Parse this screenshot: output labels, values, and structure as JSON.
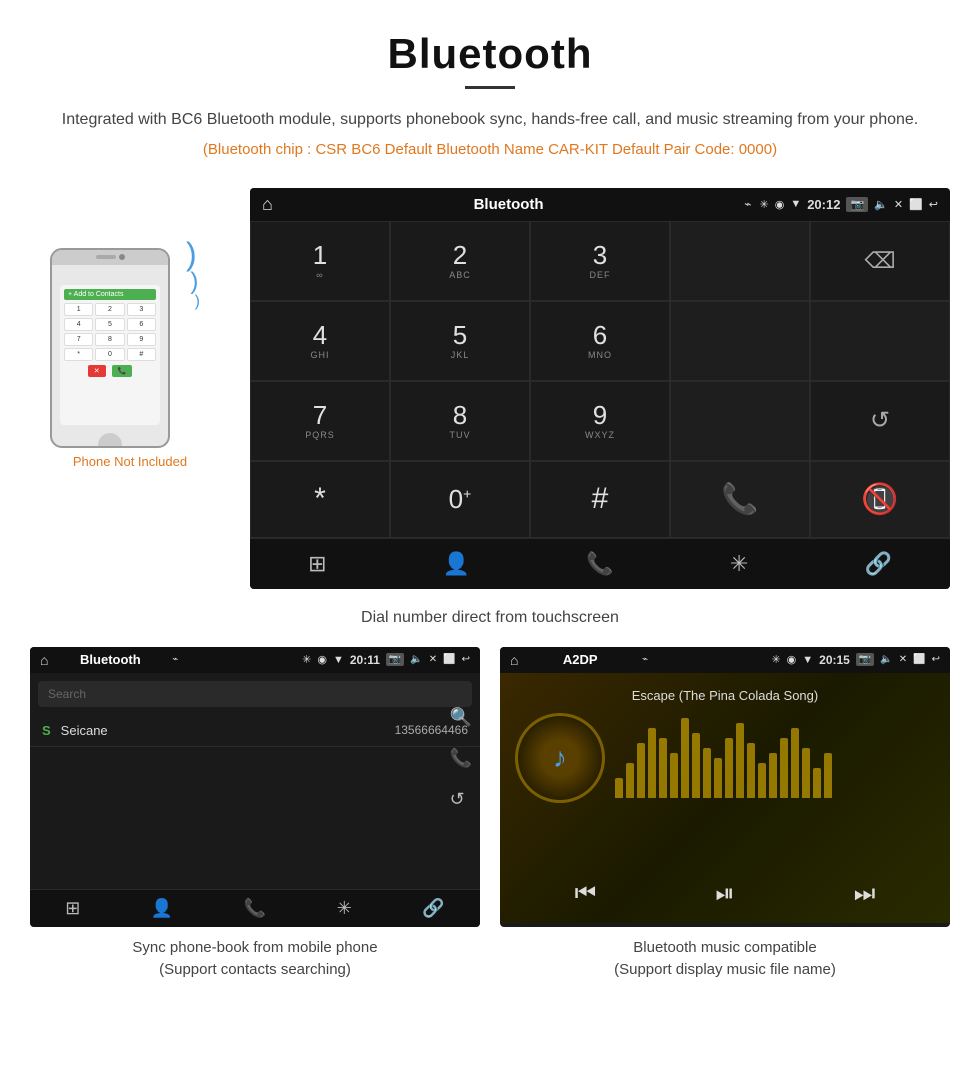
{
  "page": {
    "title": "Bluetooth",
    "divider": true,
    "description": "Integrated with BC6 Bluetooth module, supports phonebook sync, hands-free call, and music streaming from your phone.",
    "specs": "(Bluetooth chip : CSR BC6    Default Bluetooth Name CAR-KIT    Default Pair Code: 0000)"
  },
  "phone_label": "Phone Not Included",
  "car_screen": {
    "status_bar": {
      "title": "Bluetooth",
      "time": "20:12",
      "usb_icon": "⌁",
      "bt_icon": "✳",
      "location_icon": "◉",
      "signal_icon": "▼",
      "camera_icon": "⬜",
      "volume_icon": "◁",
      "close_icon": "✕",
      "rect_icon": "⬜",
      "back_icon": "↩"
    },
    "dialpad": {
      "keys": [
        {
          "num": "1",
          "sub": "∞"
        },
        {
          "num": "2",
          "sub": "ABC"
        },
        {
          "num": "3",
          "sub": "DEF"
        },
        {
          "num": "",
          "sub": ""
        },
        {
          "num": "⌫",
          "sub": ""
        },
        {
          "num": "4",
          "sub": "GHI"
        },
        {
          "num": "5",
          "sub": "JKL"
        },
        {
          "num": "6",
          "sub": "MNO"
        },
        {
          "num": "",
          "sub": ""
        },
        {
          "num": "",
          "sub": ""
        },
        {
          "num": "7",
          "sub": "PQRS"
        },
        {
          "num": "8",
          "sub": "TUV"
        },
        {
          "num": "9",
          "sub": "WXYZ"
        },
        {
          "num": "",
          "sub": ""
        },
        {
          "num": "↺",
          "sub": ""
        },
        {
          "num": "*",
          "sub": ""
        },
        {
          "num": "0",
          "sub": "+"
        },
        {
          "num": "#",
          "sub": ""
        },
        {
          "num": "📞",
          "sub": ""
        },
        {
          "num": "📵",
          "sub": ""
        }
      ]
    },
    "toolbar": {
      "items": [
        "⊞",
        "👤",
        "📞",
        "✳",
        "🔗"
      ]
    }
  },
  "main_caption": "Dial number direct from touchscreen",
  "phonebook_screen": {
    "status": {
      "title": "Bluetooth",
      "time": "20:11"
    },
    "search_placeholder": "Search",
    "contacts": [
      {
        "letter": "S",
        "name": "Seicane",
        "number": "13566664466"
      }
    ]
  },
  "phonebook_caption": "Sync phone-book from mobile phone\n(Support contacts searching)",
  "music_screen": {
    "status": {
      "title": "A2DP",
      "time": "20:15"
    },
    "track_name": "Escape (The Pina Colada Song)",
    "eq_bars": [
      20,
      35,
      55,
      70,
      60,
      45,
      80,
      65,
      50,
      40,
      60,
      75,
      55,
      35,
      45,
      60,
      70,
      50,
      30,
      45
    ]
  },
  "music_caption": "Bluetooth music compatible\n(Support display music file name)"
}
